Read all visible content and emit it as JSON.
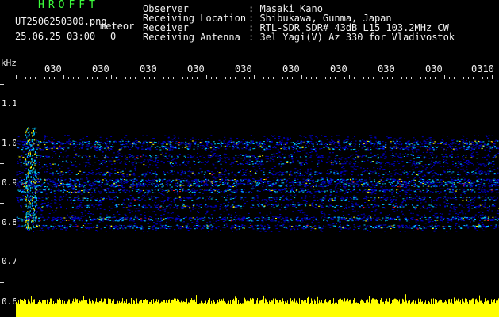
{
  "brand": "HROFFT",
  "file_name": "UT2506250300.png",
  "tag": "meteor",
  "timestamp": "25.06.25 03:00",
  "timestamp_extra": "0",
  "header": {
    "observer_label": "Observer",
    "observer_value": ": Masaki Kano",
    "location_label": "Receiving Location",
    "location_value": ": Shibukawa, Gunma, Japan",
    "receiver_label": "Receiver",
    "receiver_value": ": RTL-SDR SDR# 43dB L15 103.2MHz CW",
    "antenna_label": "Receiving Antenna",
    "antenna_value": ": 3el Yagi(V) Az 330 for Vladivostok"
  },
  "axis": {
    "unit": "kHz",
    "y_labels": [
      "1.1",
      "1.0",
      "0.9",
      "0.8",
      "0.7",
      "0.6"
    ],
    "x_labels": [
      "030",
      "030",
      "030",
      "030",
      "030",
      "030",
      "030",
      "030",
      "030",
      "0310"
    ]
  },
  "colors": {
    "background": "#000000",
    "text_white": "#f2f2f2",
    "brand_green": "#3cff3c",
    "spectrum_low": "#0000c8",
    "spectrum_mid": "#00c8ff",
    "spectrum_high": "#ffff00",
    "spectrum_peak": "#ff2020",
    "level_bar": "#ffff00"
  }
}
